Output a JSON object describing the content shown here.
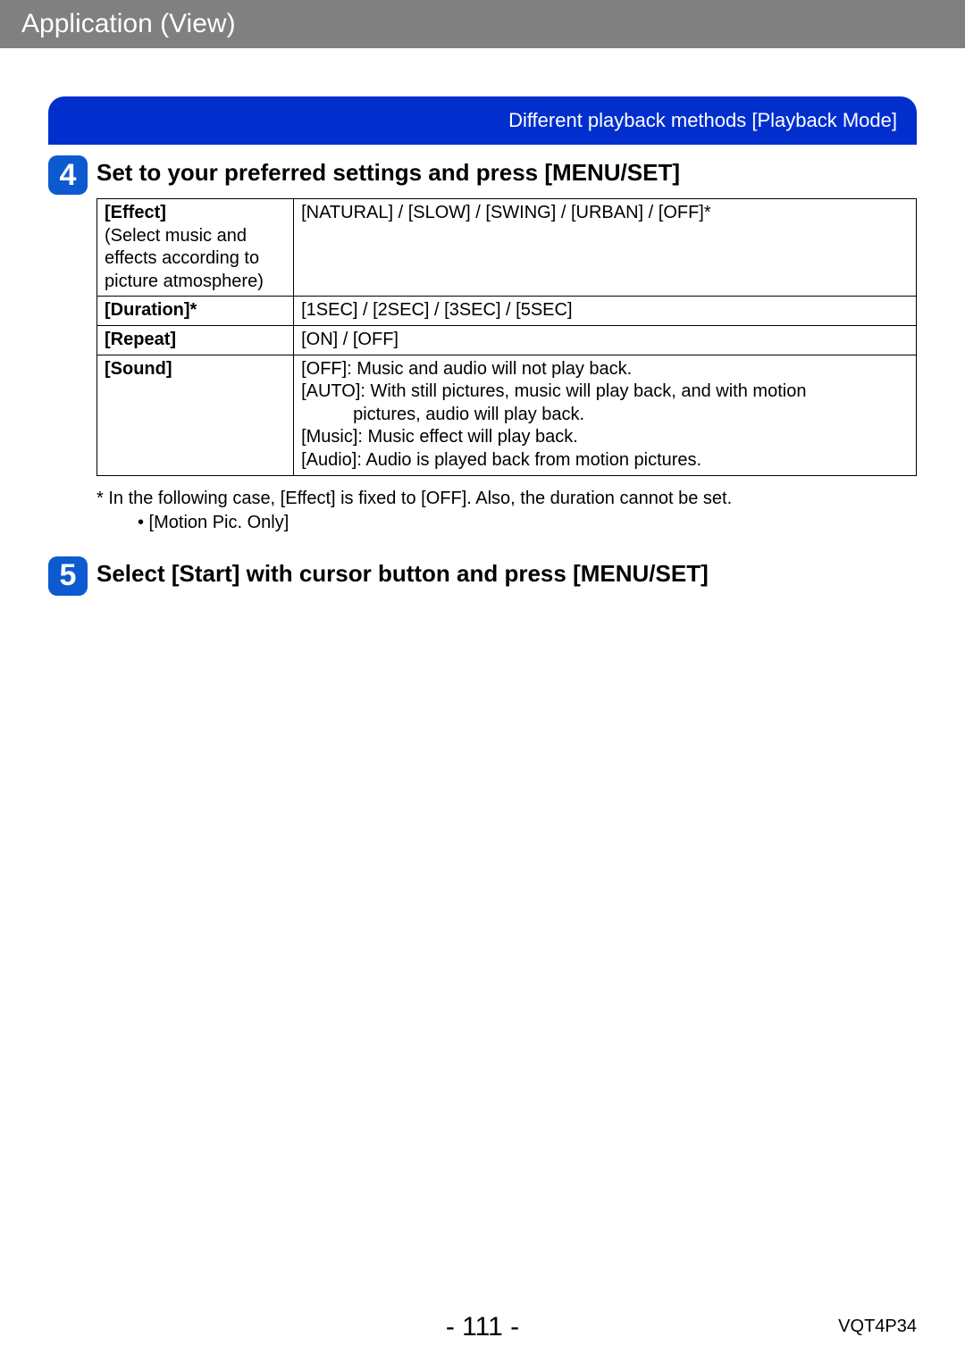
{
  "header": {
    "title": "Application (View)"
  },
  "breadcrumb": "Different playback methods  [Playback Mode]",
  "step4": {
    "number": "4",
    "title": "Set to your preferred settings and press [MENU/SET]",
    "rows": [
      {
        "label": "[Effect]",
        "sublabel": "(Select music and effects according to picture atmosphere)",
        "value": "[NATURAL] / [SLOW] / [SWING] / [URBAN] / [OFF]*"
      },
      {
        "label": "[Duration]*",
        "value": "[1SEC] / [2SEC] / [3SEC] / [5SEC]"
      },
      {
        "label": "[Repeat]",
        "value": "[ON] / [OFF]"
      },
      {
        "label": "[Sound]",
        "lines": [
          "[OFF]: Music and audio will not play back.",
          "[AUTO]: With still pictures, music will play back, and with motion",
          "pictures, audio will play back.",
          "[Music]: Music effect will play back.",
          "[Audio]: Audio is played back from motion pictures."
        ]
      }
    ],
    "footnote_star": "* In the following case, [Effect] is fixed to [OFF]. Also, the duration cannot be set.",
    "footnote_bullet": "• [Motion Pic. Only]"
  },
  "step5": {
    "number": "5",
    "title": "Select [Start] with cursor button and press [MENU/SET]"
  },
  "footer": {
    "page": "- 111 -",
    "code": "VQT4P34"
  }
}
